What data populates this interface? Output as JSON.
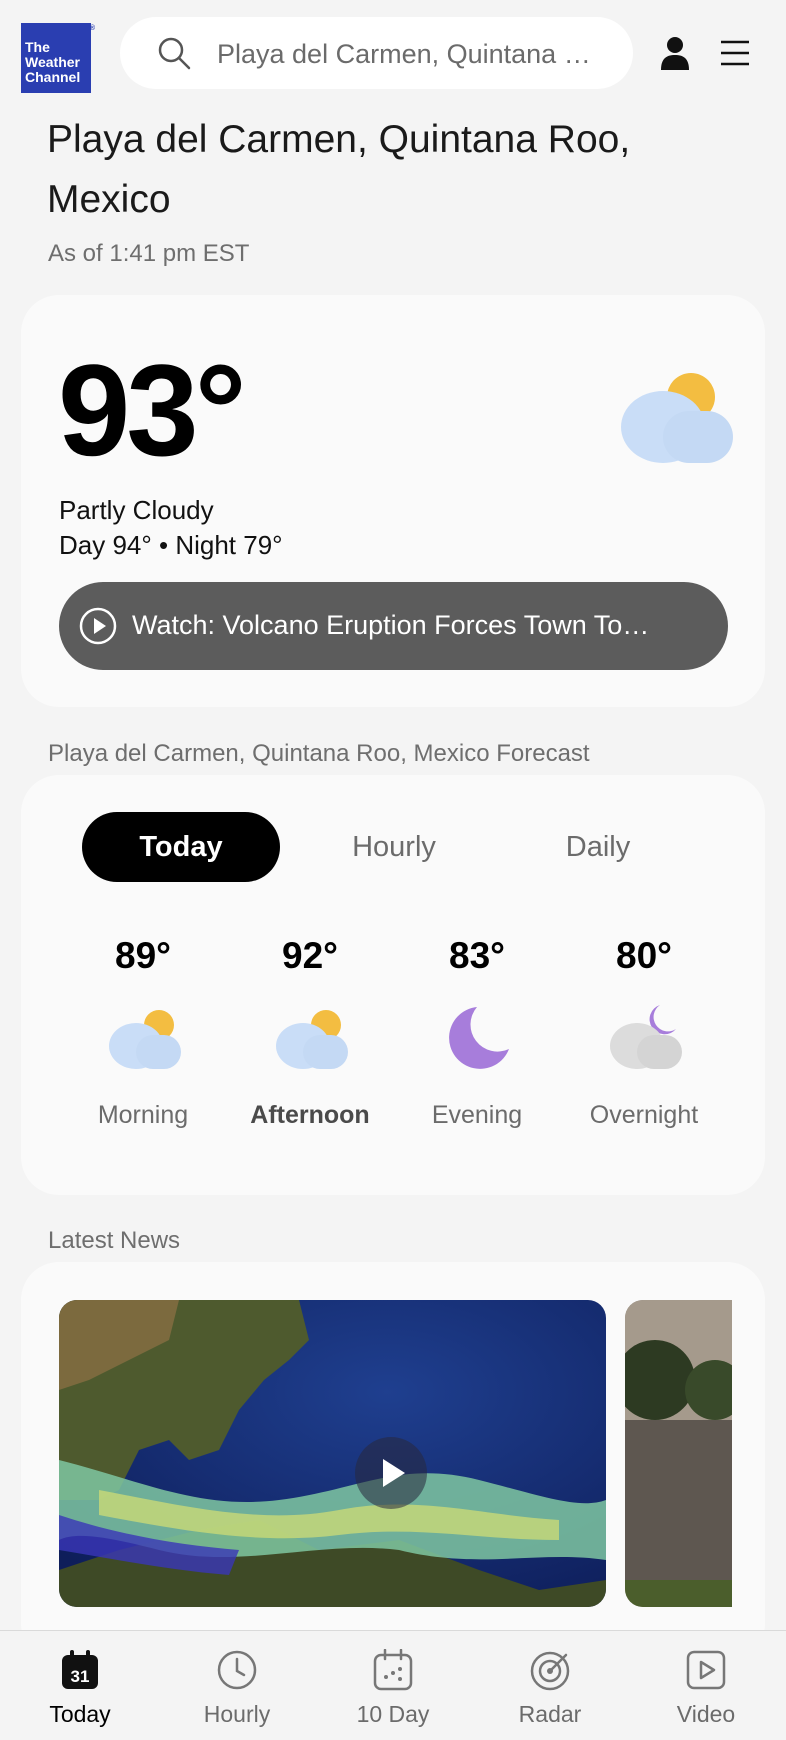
{
  "header": {
    "logo_lines": [
      "The",
      "Weather",
      "Channel"
    ],
    "search_value": "Playa del Carmen, Quintana …"
  },
  "location": {
    "title": "Playa del Carmen, Quintana Roo, Mexico",
    "as_of": "As of 1:41 pm EST"
  },
  "current": {
    "temperature": "93°",
    "condition": "Partly Cloudy",
    "day_night": "Day 94° • Night 79°",
    "icon": "partly-cloudy-icon",
    "watch_label": "Watch: Volcano Eruption Forces Town To…"
  },
  "forecast": {
    "heading": "Playa del Carmen, Quintana Roo, Mexico Forecast",
    "tabs": [
      {
        "label": "Today",
        "active": true
      },
      {
        "label": "Hourly",
        "active": false
      },
      {
        "label": "Daily",
        "active": false
      }
    ],
    "periods": [
      {
        "temp": "89°",
        "name": "Morning",
        "icon": "partly-cloudy-icon"
      },
      {
        "temp": "92°",
        "name": "Afternoon",
        "icon": "partly-cloudy-icon"
      },
      {
        "temp": "83°",
        "name": "Evening",
        "icon": "moon-icon"
      },
      {
        "temp": "80°",
        "name": "Overnight",
        "icon": "cloudy-night-icon"
      }
    ]
  },
  "news": {
    "heading": "Latest News"
  },
  "bottom_nav": {
    "calendar_day": "31",
    "items": [
      {
        "label": "Today",
        "icon": "calendar-today-icon",
        "active": true
      },
      {
        "label": "Hourly",
        "icon": "clock-icon",
        "active": false
      },
      {
        "label": "10 Day",
        "icon": "calendar-icon",
        "active": false
      },
      {
        "label": "Radar",
        "icon": "radar-icon",
        "active": false
      },
      {
        "label": "Video",
        "icon": "video-icon",
        "active": false
      }
    ]
  },
  "colors": {
    "logo_blue": "#2a3eb1",
    "sun": "#f3bd41",
    "cloud": "#c9ddf7",
    "moon": "#a77ddb",
    "night_cloud": "#dcdcdc",
    "watch_bg": "#5c5c5c"
  }
}
